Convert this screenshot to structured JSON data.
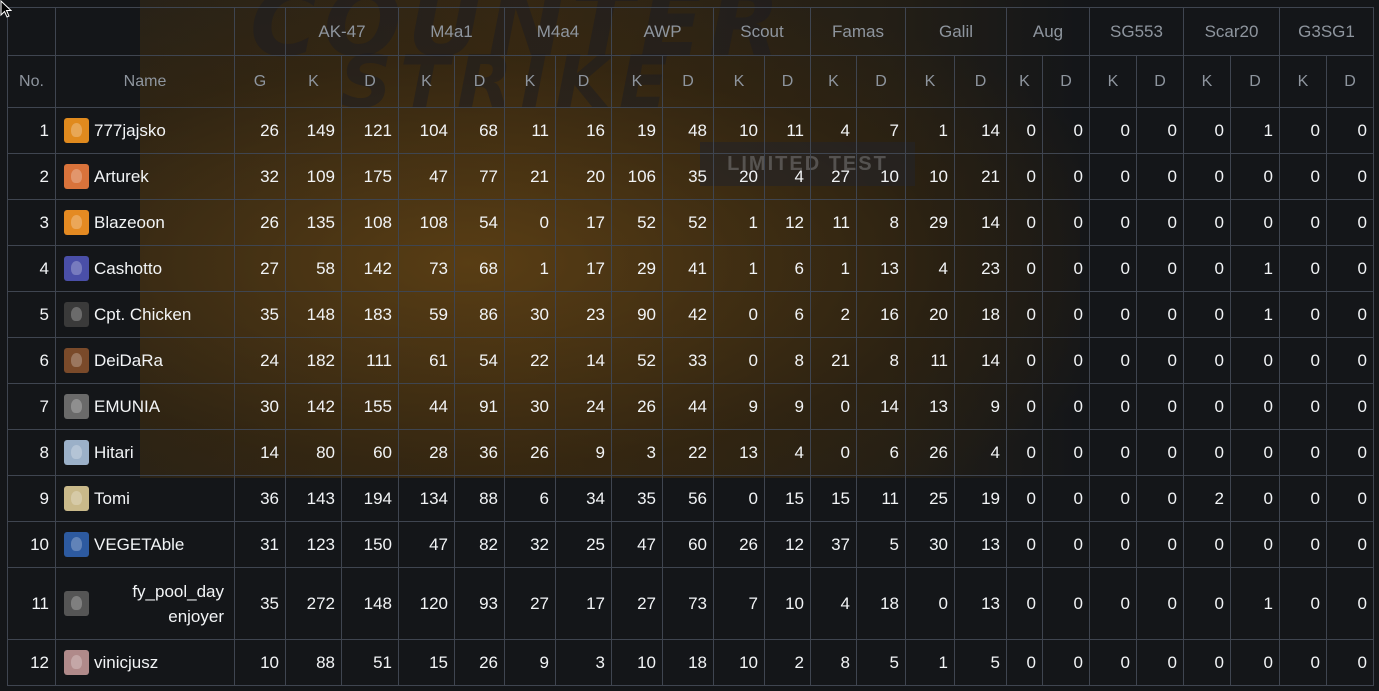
{
  "table": {
    "group_headers": [
      {
        "label": "AK-47",
        "span": 2
      },
      {
        "label": "M4a1",
        "span": 2
      },
      {
        "label": "M4a4",
        "span": 2
      },
      {
        "label": "AWP",
        "span": 2
      },
      {
        "label": "Scout",
        "span": 2
      },
      {
        "label": "Famas",
        "span": 2
      },
      {
        "label": "Galil",
        "span": 2
      },
      {
        "label": "Aug",
        "span": 2
      },
      {
        "label": "SG553",
        "span": 2
      },
      {
        "label": "Scar20",
        "span": 2
      },
      {
        "label": "G3SG1",
        "span": 2
      }
    ],
    "sub_headers": [
      "No.",
      "Name",
      "G",
      "K",
      "D",
      "K",
      "D",
      "K",
      "D",
      "K",
      "D",
      "K",
      "D",
      "K",
      "D",
      "K",
      "D",
      "K",
      "D",
      "K",
      "D",
      "K",
      "D",
      "K",
      "D"
    ],
    "rows": [
      {
        "no": "1",
        "name": "777jajsko",
        "avatar_color": "#e08a1e",
        "values": [
          "26",
          "149",
          "121",
          "104",
          "68",
          "11",
          "16",
          "19",
          "48",
          "10",
          "11",
          "4",
          "7",
          "1",
          "14",
          "0",
          "0",
          "0",
          "0",
          "0",
          "1",
          "0",
          "0"
        ]
      },
      {
        "no": "2",
        "name": "Arturek",
        "avatar_color": "#d9733b",
        "values": [
          "32",
          "109",
          "175",
          "47",
          "77",
          "21",
          "20",
          "106",
          "35",
          "20",
          "4",
          "27",
          "10",
          "10",
          "21",
          "0",
          "0",
          "0",
          "0",
          "0",
          "0",
          "0",
          "0"
        ]
      },
      {
        "no": "3",
        "name": "Blazeoon",
        "avatar_color": "#e48a22",
        "values": [
          "26",
          "135",
          "108",
          "108",
          "54",
          "0",
          "17",
          "52",
          "52",
          "1",
          "12",
          "11",
          "8",
          "29",
          "14",
          "0",
          "0",
          "0",
          "0",
          "0",
          "0",
          "0",
          "0"
        ]
      },
      {
        "no": "4",
        "name": "Cashotto",
        "avatar_color": "#4a4fa8",
        "values": [
          "27",
          "58",
          "142",
          "73",
          "68",
          "1",
          "17",
          "29",
          "41",
          "1",
          "6",
          "1",
          "13",
          "4",
          "23",
          "0",
          "0",
          "0",
          "0",
          "0",
          "1",
          "0",
          "0"
        ]
      },
      {
        "no": "5",
        "name": "Cpt. Chicken",
        "avatar_color": "#3a3a3a",
        "values": [
          "35",
          "148",
          "183",
          "59",
          "86",
          "30",
          "23",
          "90",
          "42",
          "0",
          "6",
          "2",
          "16",
          "20",
          "18",
          "0",
          "0",
          "0",
          "0",
          "0",
          "1",
          "0",
          "0"
        ]
      },
      {
        "no": "6",
        "name": "DeiDaRa",
        "avatar_color": "#7a4a2a",
        "values": [
          "24",
          "182",
          "111",
          "61",
          "54",
          "22",
          "14",
          "52",
          "33",
          "0",
          "8",
          "21",
          "8",
          "11",
          "14",
          "0",
          "0",
          "0",
          "0",
          "0",
          "0",
          "0",
          "0"
        ]
      },
      {
        "no": "7",
        "name": "EMUNIA",
        "avatar_color": "#6a6a6a",
        "values": [
          "30",
          "142",
          "155",
          "44",
          "91",
          "30",
          "24",
          "26",
          "44",
          "9",
          "9",
          "0",
          "14",
          "13",
          "9",
          "0",
          "0",
          "0",
          "0",
          "0",
          "0",
          "0",
          "0"
        ]
      },
      {
        "no": "8",
        "name": "Hitari",
        "avatar_color": "#9bb0c8",
        "values": [
          "14",
          "80",
          "60",
          "28",
          "36",
          "26",
          "9",
          "3",
          "22",
          "13",
          "4",
          "0",
          "6",
          "26",
          "4",
          "0",
          "0",
          "0",
          "0",
          "0",
          "0",
          "0",
          "0"
        ]
      },
      {
        "no": "9",
        "name": "Tomi",
        "avatar_color": "#c9b98a",
        "values": [
          "36",
          "143",
          "194",
          "134",
          "88",
          "6",
          "34",
          "35",
          "56",
          "0",
          "15",
          "15",
          "11",
          "25",
          "19",
          "0",
          "0",
          "0",
          "0",
          "2",
          "0",
          "0",
          "0"
        ]
      },
      {
        "no": "10",
        "name": "VEGETAble",
        "avatar_color": "#2d5aa0",
        "values": [
          "31",
          "123",
          "150",
          "47",
          "82",
          "32",
          "25",
          "47",
          "60",
          "26",
          "12",
          "37",
          "5",
          "30",
          "13",
          "0",
          "0",
          "0",
          "0",
          "0",
          "0",
          "0",
          "0"
        ]
      },
      {
        "no": "11",
        "name": "fy_pool_day enjoyer",
        "avatar_color": "#555555",
        "values": [
          "35",
          "272",
          "148",
          "120",
          "93",
          "27",
          "17",
          "27",
          "73",
          "7",
          "10",
          "4",
          "18",
          "0",
          "13",
          "0",
          "0",
          "0",
          "0",
          "0",
          "1",
          "0",
          "0"
        ]
      },
      {
        "no": "12",
        "name": "vinicjusz",
        "avatar_color": "#b08a8a",
        "values": [
          "10",
          "88",
          "51",
          "15",
          "26",
          "9",
          "3",
          "10",
          "18",
          "10",
          "2",
          "8",
          "5",
          "1",
          "5",
          "0",
          "0",
          "0",
          "0",
          "0",
          "0",
          "0",
          "0"
        ]
      }
    ]
  },
  "background": {
    "title_line1": "COUNTER",
    "title_line2": "STRIKE",
    "badge": "LIMITED TEST"
  }
}
